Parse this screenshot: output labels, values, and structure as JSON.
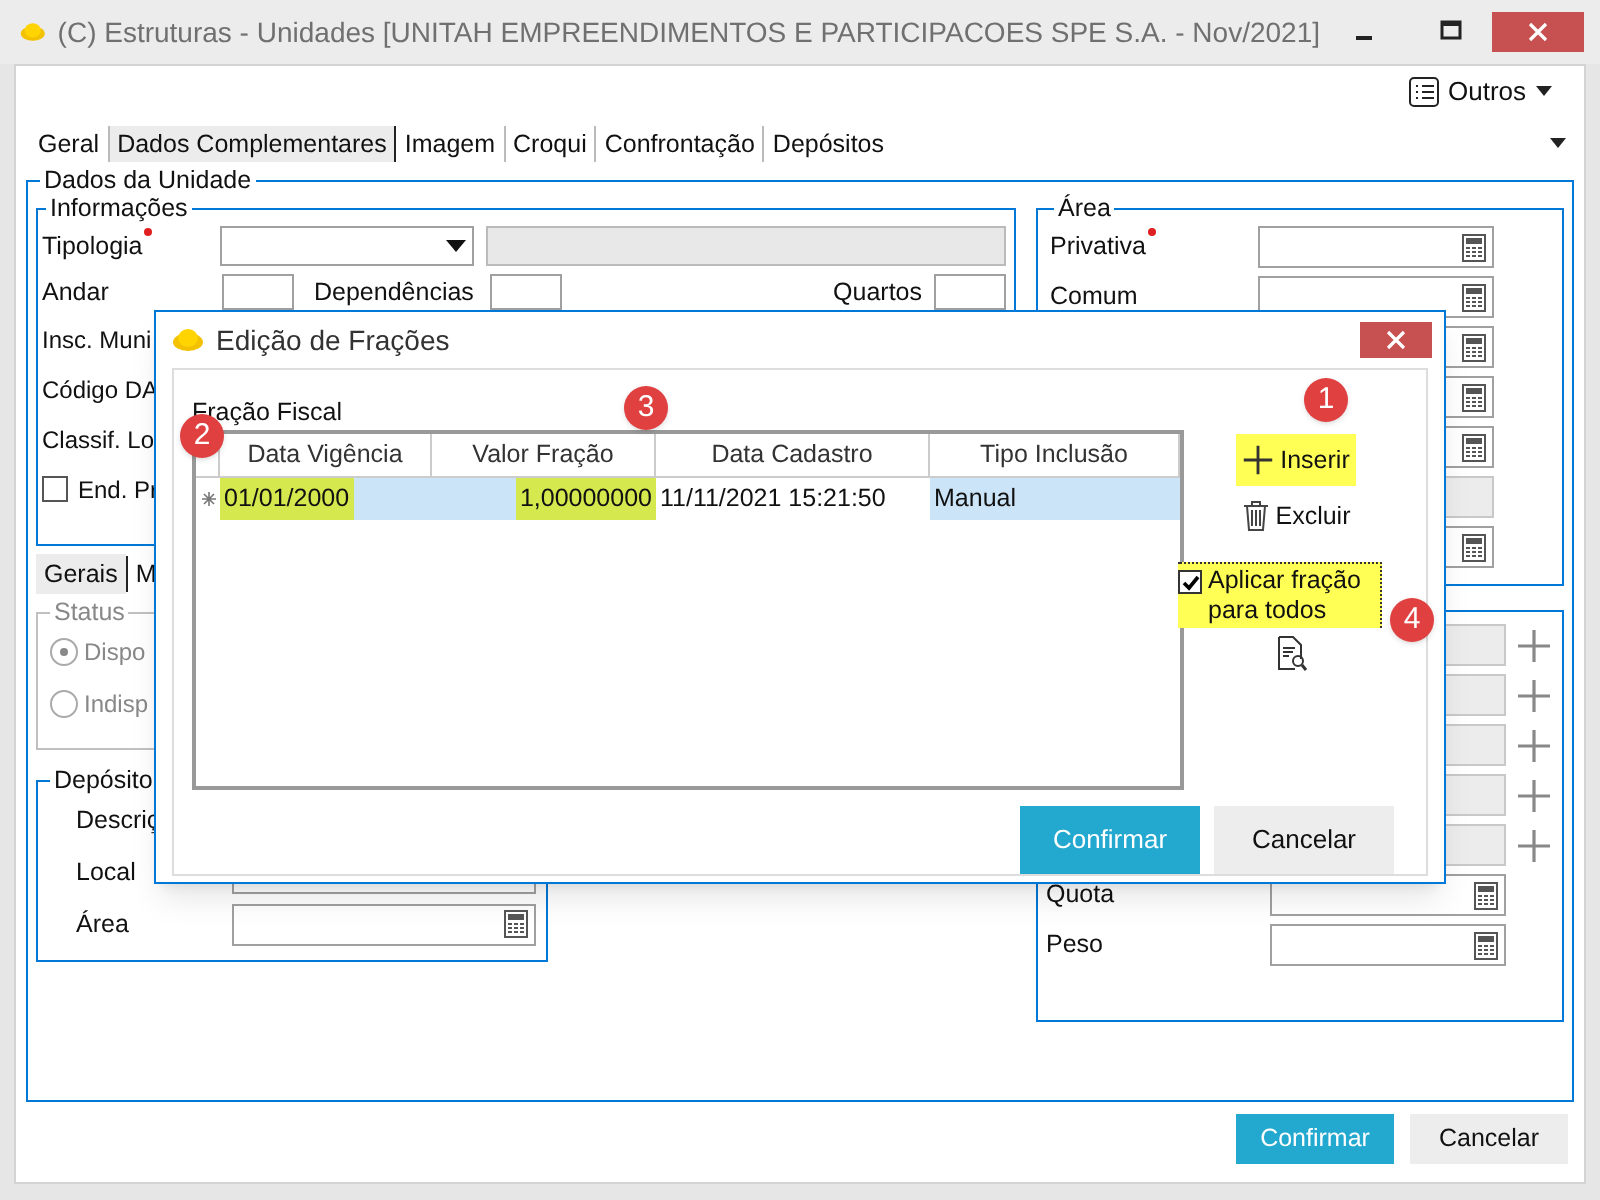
{
  "window": {
    "title": "(C) Estruturas - Unidades [UNITAH EMPREENDIMENTOS E PARTICIPACOES SPE S.A. - Nov/2021]"
  },
  "toolbar": {
    "menu_button": "Outros"
  },
  "tabs": [
    {
      "label": "Geral",
      "selected": false
    },
    {
      "label": "Dados Complementares",
      "selected": true
    },
    {
      "label": "Imagem",
      "selected": false
    },
    {
      "label": "Croqui",
      "selected": false
    },
    {
      "label": "Confrontação",
      "selected": false
    },
    {
      "label": "Depósitos",
      "selected": false
    }
  ],
  "group_title": "Dados da Unidade",
  "informacoes": {
    "title": "Informações",
    "tipologia": {
      "label": "Tipologia",
      "required": true
    },
    "andar": "Andar",
    "dependencias": "Dependências",
    "quartos": "Quartos",
    "labels": [
      "Insc. Muni",
      "Código DA",
      "Classif. Lo"
    ],
    "checkbox": {
      "label": "End. Pr",
      "checked": false
    }
  },
  "lower_tabs": [
    {
      "label": "Gerais",
      "selected": true
    },
    {
      "label": "M",
      "selected": false
    }
  ],
  "status": {
    "title": "Status",
    "options": [
      {
        "label": "Dispo",
        "selected": true
      },
      {
        "label": "Indisp",
        "selected": false
      }
    ]
  },
  "deposito": {
    "title": "Depósito",
    "rows": [
      {
        "label": "Descriç",
        "kind": "hidden"
      },
      {
        "label": "Local",
        "kind": "text"
      },
      {
        "label": "Área",
        "kind": "calc"
      }
    ]
  },
  "area": {
    "title": "Área",
    "rows": [
      {
        "label": "Privativa",
        "required": true,
        "kind": "calc"
      },
      {
        "label": "Comum",
        "required": false,
        "kind": "calc"
      },
      {
        "kind": "calc"
      },
      {
        "kind": "calc"
      },
      {
        "kind": "calc"
      },
      {
        "kind": "disabled"
      },
      {
        "kind": "calc"
      }
    ]
  },
  "area_extra": {
    "rows": [
      {
        "kind": "add"
      },
      {
        "kind": "add"
      },
      {
        "kind": "add"
      },
      {
        "kind": "add"
      },
      {
        "kind": "add"
      },
      {
        "label": "Quota",
        "kind": "calc"
      },
      {
        "label": "Peso",
        "kind": "calc"
      }
    ]
  },
  "buttons": [
    {
      "label": "Confirmar",
      "kind": "primary"
    },
    {
      "label": "Cancelar",
      "kind": "secondary"
    }
  ],
  "dialog": {
    "title": "Edição de Frações",
    "section": "Fração Fiscal",
    "columns": [
      {
        "label": "Data Vigência",
        "badge": "2"
      },
      {
        "label": "Valor Fração",
        "badge": "3"
      },
      {
        "label": "Data Cadastro"
      },
      {
        "label": "Tipo Inclusão"
      }
    ],
    "rows": [
      {
        "selected": true,
        "cells": [
          {
            "text": "01/01/2000",
            "highlighted": true,
            "focused": false
          },
          {
            "text": "1,00000000",
            "highlighted": true,
            "focused": false
          },
          {
            "text": "11/11/2021 15:21:50",
            "highlighted": false,
            "focused": true
          },
          {
            "text": "Manual",
            "highlighted": false,
            "focused": false
          }
        ]
      }
    ],
    "actions": [
      {
        "label": "Inserir",
        "kind": "insert",
        "highlighted": true,
        "badge": "1"
      },
      {
        "label": "Excluir",
        "kind": "delete",
        "highlighted": false
      }
    ],
    "apply_all": {
      "label": "Aplicar fração para todos",
      "checked": true,
      "highlighted": true,
      "badge": "4"
    },
    "buttons": [
      {
        "label": "Confirmar",
        "kind": "primary"
      },
      {
        "label": "Cancelar",
        "kind": "secondary"
      }
    ]
  }
}
